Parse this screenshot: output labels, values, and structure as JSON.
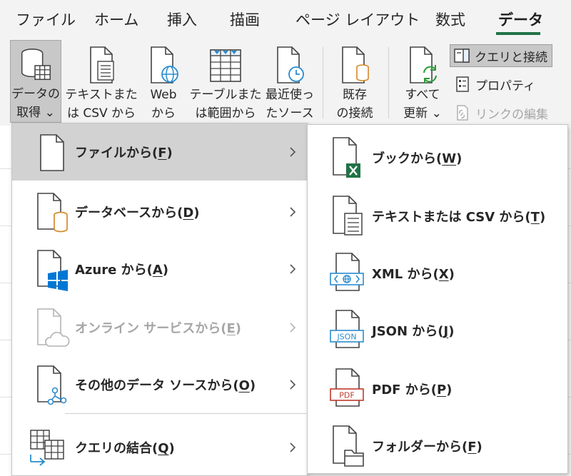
{
  "tabs": [
    {
      "label": "ファイル"
    },
    {
      "label": "ホーム"
    },
    {
      "label": "挿入"
    },
    {
      "label": "描画"
    },
    {
      "label": "ページ レイアウト"
    },
    {
      "label": "数式"
    },
    {
      "label": "データ"
    }
  ],
  "active_tab": "データ",
  "ribbon": {
    "get_data": {
      "line1": "データの",
      "line2": "取得 ⌄"
    },
    "text_csv": {
      "line1": "テキストまた",
      "line2": "は CSV から"
    },
    "web": {
      "line1": "Web",
      "line2": "から"
    },
    "table_range": {
      "line1": "テーブルまた",
      "line2": "は範囲から"
    },
    "recent_sources": {
      "line1": "最近使っ",
      "line2": "たソース"
    },
    "existing_conn": {
      "line1": "既存",
      "line2": "の接続"
    },
    "refresh_all": {
      "line1": "すべて",
      "line2": "更新 ⌄"
    },
    "queries_connections": "クエリと接続",
    "properties": "プロパティ",
    "edit_links": "リンクの編集"
  },
  "menu_left": {
    "items": [
      {
        "label": "ファイルから(",
        "key": "F",
        "suffix": ")",
        "icon": "file-icon",
        "highlighted": true,
        "disabled": false
      },
      {
        "label": "データベースから(",
        "key": "D",
        "suffix": ")",
        "icon": "database-icon",
        "highlighted": false,
        "disabled": false
      },
      {
        "label": "Azure から(",
        "key": "A",
        "suffix": ")",
        "icon": "azure-icon",
        "highlighted": false,
        "disabled": false
      },
      {
        "label": "オンライン サービスから(",
        "key": "E",
        "suffix": ")",
        "icon": "cloud-icon",
        "highlighted": false,
        "disabled": true
      },
      {
        "label": "その他のデータ ソースから(",
        "key": "O",
        "suffix": ")",
        "icon": "other-sources-icon",
        "highlighted": false,
        "disabled": false
      },
      {
        "label": "クエリの結合(",
        "key": "Q",
        "suffix": ")",
        "icon": "combine-queries-icon",
        "highlighted": false,
        "disabled": false
      }
    ]
  },
  "menu_right": {
    "items": [
      {
        "label": "ブックから(",
        "key": "W",
        "suffix": ")",
        "icon": "excel-workbook-icon"
      },
      {
        "label": "テキストまたは CSV から(",
        "key": "T",
        "suffix": ")",
        "icon": "text-file-icon"
      },
      {
        "label": "XML から(",
        "key": "X",
        "suffix": ")",
        "icon": "xml-icon",
        "badge": ""
      },
      {
        "label": "JSON から(",
        "key": "J",
        "suffix": ")",
        "icon": "json-icon",
        "badge": "JSON"
      },
      {
        "label": "PDF から(",
        "key": "P",
        "suffix": ")",
        "icon": "pdf-icon",
        "badge": "PDF"
      },
      {
        "label": "フォルダーから(",
        "key": "F",
        "suffix": ")",
        "icon": "folder-icon"
      }
    ]
  },
  "colors": {
    "excel_green": "#217346",
    "azure_blue": "#0078d4",
    "database_orange": "#d48a2b",
    "refresh_green": "#2e9c3a",
    "pdf_red": "#c0392b",
    "xml_blue": "#2a8ccf"
  }
}
